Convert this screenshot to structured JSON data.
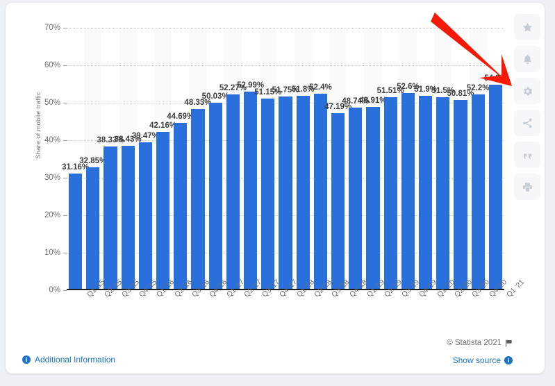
{
  "chart_data": {
    "type": "bar",
    "title": "",
    "xlabel": "",
    "ylabel": "Share of mobile traffic",
    "ylim": [
      0,
      70
    ],
    "ytick_labels": [
      "0%",
      "10%",
      "20%",
      "30%",
      "40%",
      "50%",
      "60%",
      "70%"
    ],
    "ytick_values": [
      0,
      10,
      20,
      30,
      40,
      50,
      60,
      70
    ],
    "grid": true,
    "legend": "none",
    "bar_color": "#2a70dd",
    "categories": [
      "Q1 '15",
      "Q2 '15",
      "Q3 '15",
      "Q4 '15",
      "Q1 '16",
      "Q2 '16",
      "Q3 '16",
      "Q4 '16",
      "Q1 '17",
      "Q2 '17",
      "Q3 '17",
      "Q4 '17",
      "Q1 '18",
      "Q2 '18",
      "Q3 '18",
      "Q4 '18",
      "Q1 '19",
      "Q2 '19",
      "Q3 '19",
      "Q4 '19",
      "Q1 '20",
      "Q2 '20",
      "Q3 '20",
      "Q4 '20",
      "Q1 '21"
    ],
    "values": [
      31.16,
      32.85,
      38.33,
      38.43,
      39.47,
      42.16,
      44.69,
      48.33,
      50.03,
      52.27,
      52.99,
      51.15,
      51.75,
      51.8,
      52.4,
      47.19,
      48.74,
      48.91,
      51.51,
      52.6,
      51.9,
      51.5,
      50.81,
      52.2,
      54.8
    ],
    "data_labels": [
      "31.16%",
      "32.85%",
      "38.33%",
      "38.43%",
      "39.47%",
      "42.16%",
      "44.69%",
      "48.33%",
      "50.03%",
      "52.27%",
      "52.99%",
      "51.15%",
      "51.75%",
      "51.8%",
      "52.4%",
      "47.19%",
      "48.74%",
      "48.91%",
      "51.51%",
      "52.6%",
      "51.9%",
      "51.5%",
      "50.81%",
      "52.2%",
      "54.8%"
    ]
  },
  "annotation": {
    "arrow_color": "#f51a08",
    "points_at": "54.8%"
  },
  "rail": {
    "items": [
      {
        "icon": "star-icon",
        "name": "favorite-button"
      },
      {
        "icon": "bell-icon",
        "name": "alert-button"
      },
      {
        "icon": "gear-icon",
        "name": "settings-button"
      },
      {
        "icon": "share-icon",
        "name": "share-button"
      },
      {
        "icon": "quote-icon",
        "name": "cite-button"
      },
      {
        "icon": "print-icon",
        "name": "print-button"
      }
    ]
  },
  "footer": {
    "additional_information": "Additional Information",
    "copyright": "© Statista 2021",
    "show_source": "Show source"
  }
}
